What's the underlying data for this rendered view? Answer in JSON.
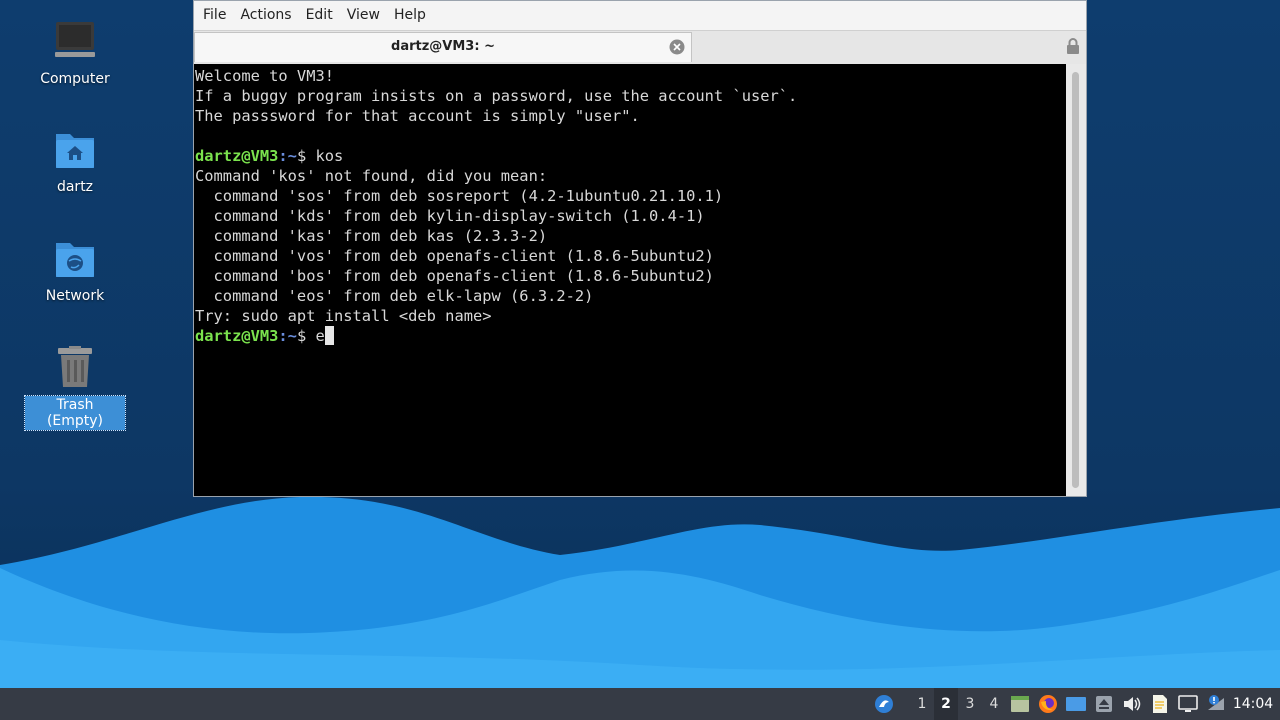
{
  "desktop": {
    "icons": [
      {
        "label": "Computer",
        "icon": "computer-icon"
      },
      {
        "label": "dartz",
        "icon": "home-folder-icon"
      },
      {
        "label": "Network",
        "icon": "network-folder-icon"
      },
      {
        "label": "Trash (Empty)",
        "icon": "trash-icon",
        "selected": true
      }
    ]
  },
  "terminal": {
    "menu": [
      "File",
      "Actions",
      "Edit",
      "View",
      "Help"
    ],
    "tab_title": "dartz@VM3: ~",
    "prompt_user": "dartz@VM3",
    "prompt_path": ":~",
    "prompt_symbol": "$ ",
    "lines": [
      "Welcome to VM3!",
      "If a buggy program insists on a password, use the account `user`.",
      "The passsword for that account is simply \"user\".",
      "",
      "Command 'kos' not found, did you mean:",
      "  command 'sos' from deb sosreport (4.2-1ubuntu0.21.10.1)",
      "  command 'kds' from deb kylin-display-switch (1.0.4-1)",
      "  command 'kas' from deb kas (2.3.3-2)",
      "  command 'vos' from deb openafs-client (1.8.6-5ubuntu2)",
      "  command 'bos' from deb openafs-client (1.8.6-5ubuntu2)",
      "  command 'eos' from deb elk-lapw (6.3.2-2)",
      "Try: sudo apt install <deb name>"
    ],
    "command_1": "kos",
    "current_input": "e"
  },
  "taskbar": {
    "workspaces": [
      "1",
      "2",
      "3",
      "4"
    ],
    "active_workspace": "2",
    "clock": "14:04",
    "tray_icons": [
      "menu-icon",
      "file-manager-icon",
      "firefox-icon",
      "desktop-icon",
      "upload-icon",
      "volume-icon",
      "notes-icon",
      "display-icon",
      "network-alert-icon"
    ]
  },
  "colors": {
    "desktop_bg": "#0e3d6e",
    "wave_light": "#34aaf1",
    "wave_mid": "#1e8fe0",
    "prompt_green": "#7be34e",
    "prompt_blue": "#6a8ddb",
    "taskbar_bg": "#363b45"
  }
}
